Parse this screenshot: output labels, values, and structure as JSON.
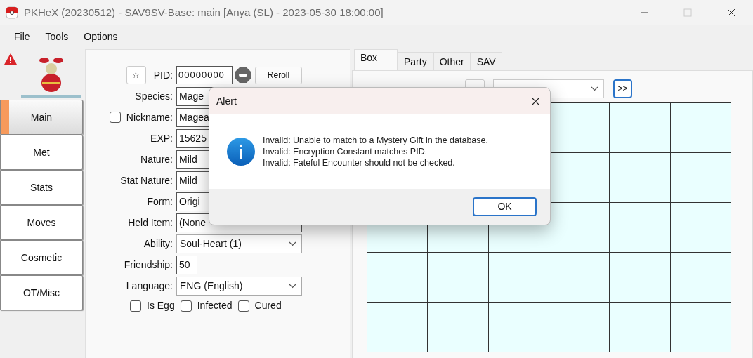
{
  "window": {
    "title": "PKHeX (20230512) - SAV9SV-Base: main [Anya (SL) - 2023-05-30 18:00:00]"
  },
  "menu": [
    "File",
    "Tools",
    "Options"
  ],
  "editor_tabs": [
    {
      "label": "Main",
      "selected": true
    },
    {
      "label": "Met",
      "selected": false
    },
    {
      "label": "Stats",
      "selected": false
    },
    {
      "label": "Moves",
      "selected": false
    },
    {
      "label": "Cosmetic",
      "selected": false
    },
    {
      "label": "OT/Misc",
      "selected": false
    }
  ],
  "pid": {
    "star": "☆",
    "label": "PID:",
    "value": "00000000",
    "reroll": "Reroll"
  },
  "rows": [
    {
      "kind": "field",
      "label": "Species:",
      "value": "Mage"
    },
    {
      "kind": "check-field",
      "label": "Nickname:",
      "value": "Magea",
      "checked": false
    },
    {
      "kind": "field",
      "label": "EXP:",
      "value": "15625"
    },
    {
      "kind": "field",
      "label": "Nature:",
      "value": "Mild"
    },
    {
      "kind": "field",
      "label": "Stat Nature:",
      "value": "Mild"
    },
    {
      "kind": "field",
      "label": "Form:",
      "value": "Origi"
    },
    {
      "kind": "field",
      "label": "Held Item:",
      "value": "(None"
    },
    {
      "kind": "select",
      "label": "Ability:",
      "value": "Soul-Heart (1)"
    },
    {
      "kind": "short",
      "label": "Friendship:",
      "value": "50_"
    },
    {
      "kind": "select",
      "label": "Language:",
      "value": "ENG (English)"
    }
  ],
  "flags": [
    {
      "label": "Is Egg",
      "checked": false
    },
    {
      "label": "Infected",
      "checked": false
    },
    {
      "label": "Cured",
      "checked": false
    }
  ],
  "box_tabs": [
    {
      "label": "Box",
      "selected": true
    },
    {
      "label": "Party",
      "selected": false
    },
    {
      "label": "Other",
      "selected": false
    },
    {
      "label": "SAV",
      "selected": false
    }
  ],
  "box_nav": {
    "next": ">>"
  },
  "alert": {
    "title": "Alert",
    "lines": [
      "Invalid: Unable to match to a Mystery Gift in the database.",
      "Invalid: Encryption Constant matches PID.",
      "Invalid: Fateful Encounter should not be checked."
    ],
    "button": "OK"
  }
}
